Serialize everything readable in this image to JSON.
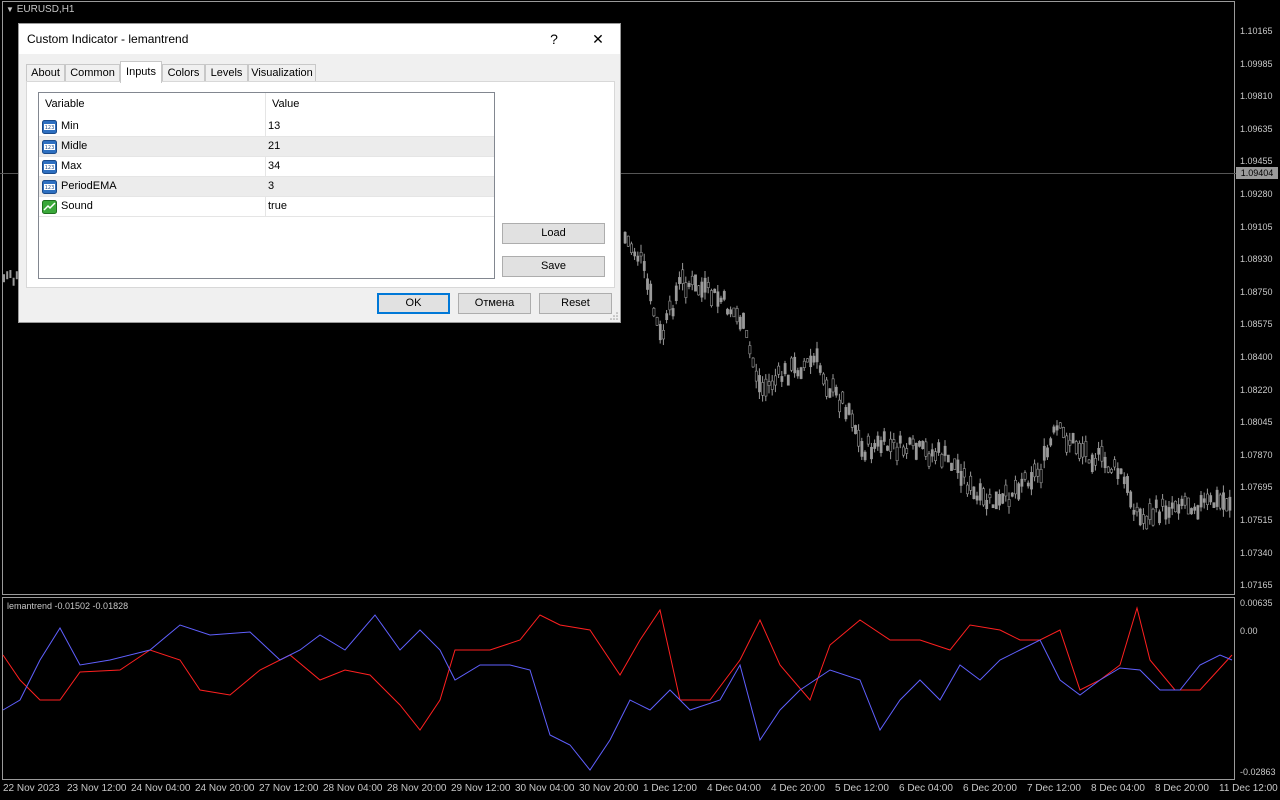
{
  "chart": {
    "symbol_label": "EURUSD,H1",
    "price_scale": [
      "1.10165",
      "1.09985",
      "1.09810",
      "1.09635",
      "1.09455",
      "1.09280",
      "1.09105",
      "1.08930",
      "1.08750",
      "1.08575",
      "1.08400",
      "1.08220",
      "1.08045",
      "1.07870",
      "1.07695",
      "1.07515",
      "1.07340",
      "1.07165"
    ],
    "current_price": "1.09404",
    "indicator_label": "lemantrend -0.01502 -0.01828",
    "indicator_scale": [
      "0.00635",
      "0.00",
      "-0.02863"
    ],
    "time_scale": [
      "22 Nov 2023",
      "23 Nov 12:00",
      "24 Nov 04:00",
      "24 Nov 20:00",
      "27 Nov 12:00",
      "28 Nov 04:00",
      "28 Nov 20:00",
      "29 Nov 12:00",
      "30 Nov 04:00",
      "30 Nov 20:00",
      "1 Dec 12:00",
      "4 Dec 04:00",
      "4 Dec 20:00",
      "5 Dec 12:00",
      "6 Dec 04:00",
      "6 Dec 20:00",
      "7 Dec 12:00",
      "8 Dec 04:00",
      "8 Dec 20:00",
      "11 Dec 12:00"
    ],
    "colors": {
      "background": "#000000",
      "candles": "#9a9a9a",
      "line_red": "#ff2020",
      "line_blue": "#6060ff"
    }
  },
  "dialog": {
    "title": "Custom Indicator - lemantrend",
    "help_label": "?",
    "close_label": "✕",
    "tabs": [
      {
        "label": "About",
        "active": false
      },
      {
        "label": "Common",
        "active": false
      },
      {
        "label": "Inputs",
        "active": true
      },
      {
        "label": "Colors",
        "active": false
      },
      {
        "label": "Levels",
        "active": false
      },
      {
        "label": "Visualization",
        "active": false
      }
    ],
    "table": {
      "headers": {
        "variable": "Variable",
        "value": "Value"
      },
      "rows": [
        {
          "name": "Min",
          "value": "13",
          "icon": "numeric-icon"
        },
        {
          "name": "Midle",
          "value": "21",
          "icon": "numeric-icon"
        },
        {
          "name": "Max",
          "value": "34",
          "icon": "numeric-icon"
        },
        {
          "name": "PeriodEMA",
          "value": "3",
          "icon": "numeric-icon"
        },
        {
          "name": "Sound",
          "value": "true",
          "icon": "boolean-icon"
        }
      ]
    },
    "load_label": "Load",
    "save_label": "Save",
    "ok_label": "OK",
    "cancel_label": "Отмена",
    "reset_label": "Reset"
  }
}
